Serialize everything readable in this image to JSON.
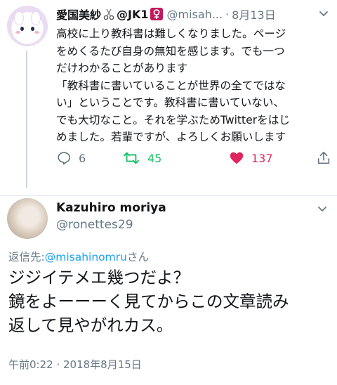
{
  "tweet": {
    "display_name": "愛国美紗",
    "name_suffix": "@JK1",
    "handle": "@misah...",
    "date": "8月13日",
    "body_lines": [
      "高校に上り教科書は難しくなりました。ページ",
      "をめくるたび自身の無知を感じます。でも一つ",
      "だけわかることがあります",
      "「教科書に書いていることが世界の全てではな",
      "い」ということです。教科書に書いていない、",
      "でも大切なこと。それを学ぶためTwitterをはじ",
      "めました。若輩ですが、よろしくお願いします"
    ],
    "reply_count": "6",
    "retweet_count": "45",
    "like_count": "137"
  },
  "reply": {
    "display_name": "Kazuhiro moriya",
    "handle": "@ronettes29",
    "replying_to_label": "返信先:",
    "replying_to_mention": "@misahinomru",
    "replying_to_suffix": "さん",
    "body_lines": [
      "ジジイテメエ幾つだよ？",
      "鏡をよーーーく見てからこの文章読み",
      "返して見やがれカス。"
    ],
    "timestamp": "午前0:22 · 2018年8月15日"
  },
  "colors": {
    "text": "#14171a",
    "secondary": "#657786",
    "link": "#1da1f2",
    "retweet": "#17bf63",
    "like": "#e0245e",
    "divider": "#e6ecf0"
  },
  "icons": [
    "scissors-icon",
    "female-sign-icon",
    "chevron-down-icon",
    "reply-icon",
    "retweet-icon",
    "heart-icon",
    "share-icon"
  ]
}
